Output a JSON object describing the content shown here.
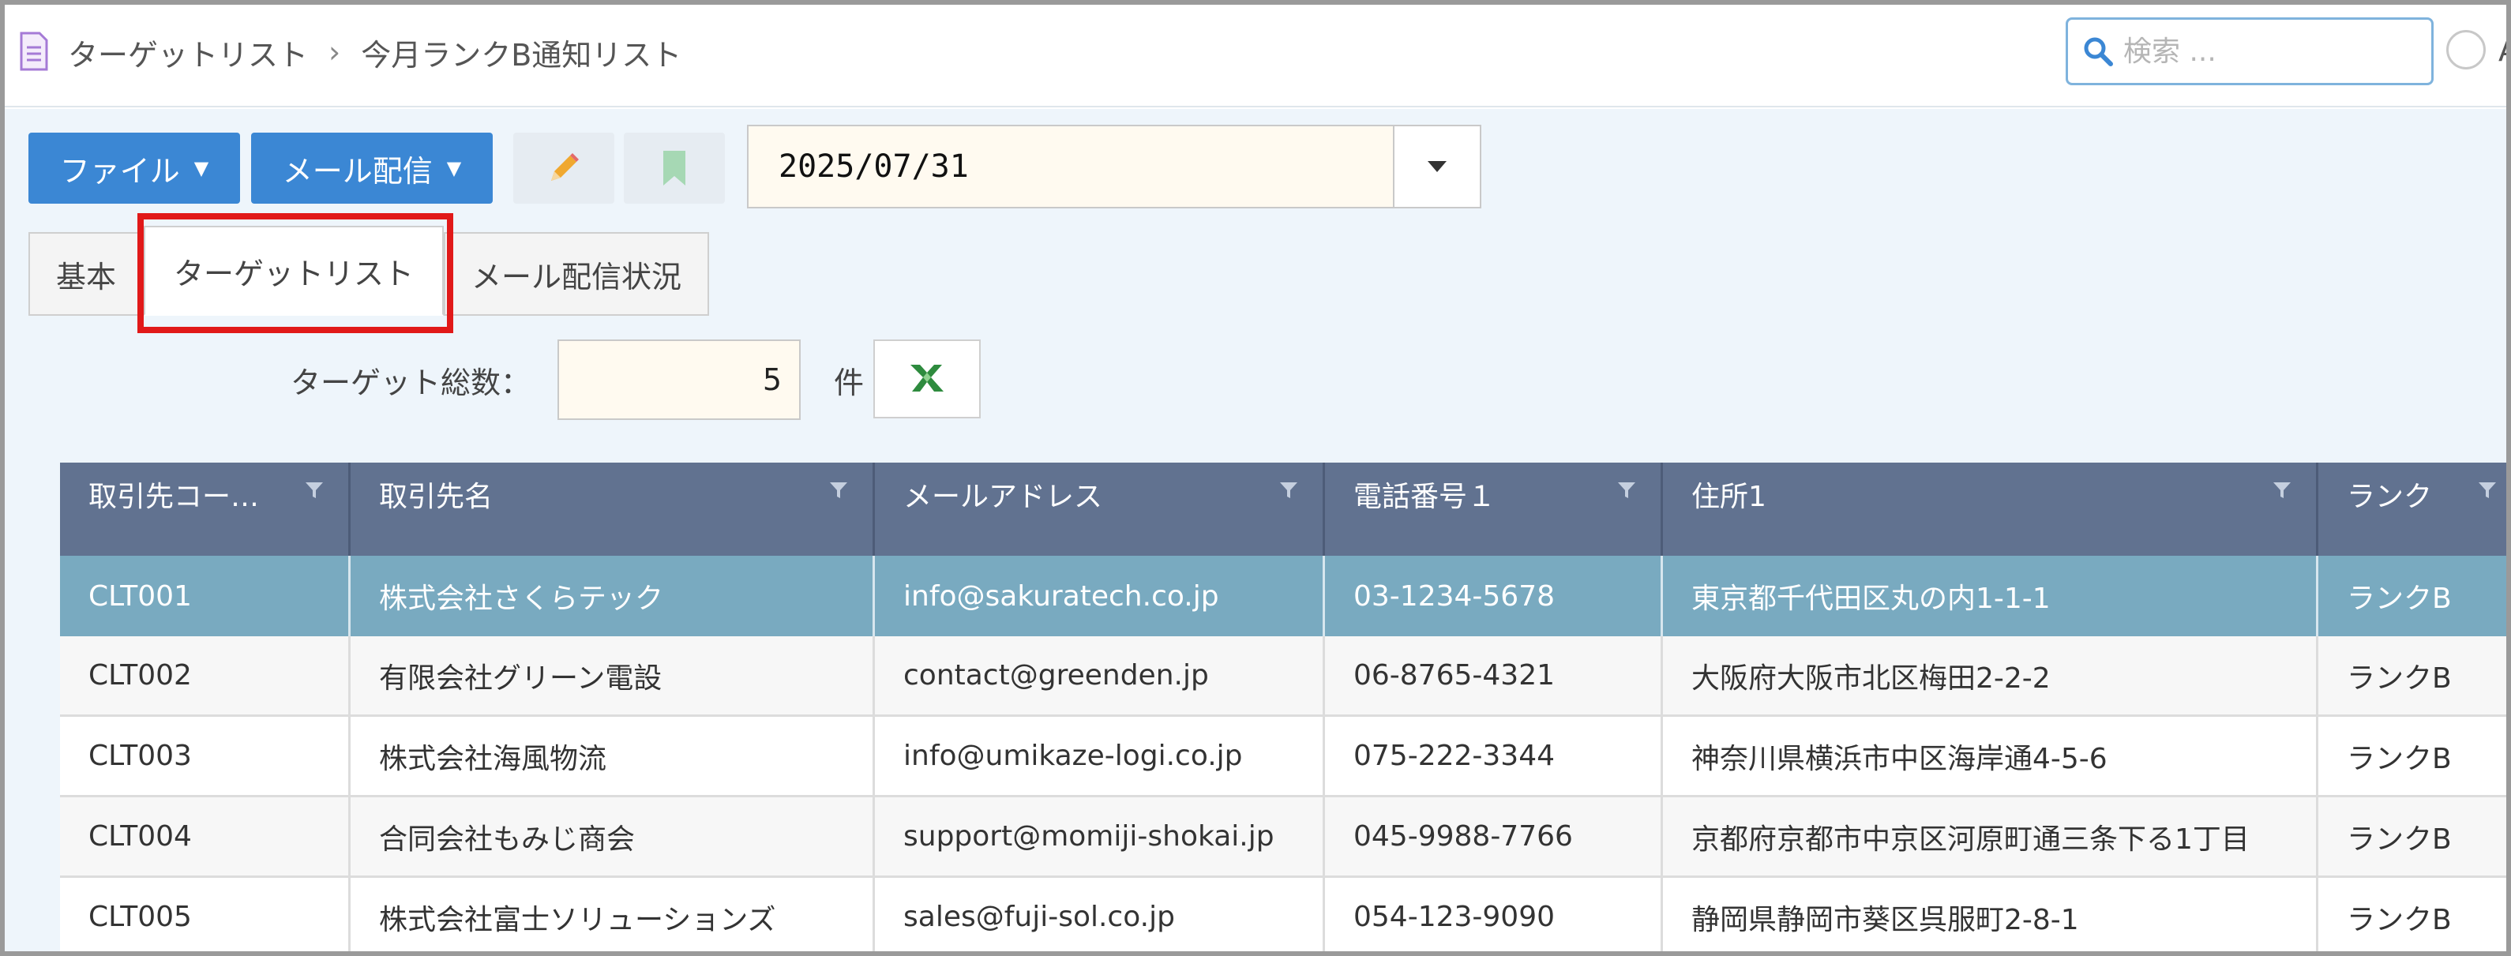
{
  "breadcrumb": [
    "ターゲットリスト",
    "今月ランクB通知リスト"
  ],
  "search": {
    "placeholder": "検索 ..."
  },
  "header": {
    "radio_label": "A"
  },
  "toolbar": {
    "file_label": "ファイル",
    "mail_label": "メール配信",
    "date_value": "2025/07/31"
  },
  "tabs": [
    "基本",
    "ターゲットリスト",
    "メール配信状況"
  ],
  "active_tab": "ターゲットリスト",
  "count": {
    "label": "ターゲット総数：",
    "value": "5",
    "unit": "件"
  },
  "table": {
    "columns": [
      "取引先コー…",
      "取引先名",
      "メールアドレス",
      "電話番号１",
      "住所1",
      "ランク"
    ],
    "rows": [
      [
        "CLT001",
        "株式会社さくらテック",
        "info@sakuratech.co.jp",
        "03-1234-5678",
        "東京都千代田区丸の内1-1-1",
        "ランクB"
      ],
      [
        "CLT002",
        "有限会社グリーン電設",
        "contact@greenden.jp",
        "06-8765-4321",
        "大阪府大阪市北区梅田2-2-2",
        "ランクB"
      ],
      [
        "CLT003",
        "株式会社海風物流",
        "info@umikaze-logi.co.jp",
        "075-222-3344",
        "神奈川県横浜市中区海岸通4-5-6",
        "ランクB"
      ],
      [
        "CLT004",
        "合同会社もみじ商会",
        "support@momiji-shokai.jp",
        "045-9988-7766",
        "京都府京都市中京区河原町通三条下る1丁目",
        "ランクB"
      ],
      [
        "CLT005",
        "株式会社富士ソリューションズ",
        "sales@fuji-sol.co.jp",
        "054-123-9090",
        "静岡県静岡市葵区呉服町2-8-1",
        "ランクB"
      ]
    ],
    "selected_row": 0
  },
  "colors": {
    "primary_button": "#3b87d4",
    "table_header": "#617290",
    "selected_row": "#79aac0",
    "highlight": "#e11919"
  }
}
